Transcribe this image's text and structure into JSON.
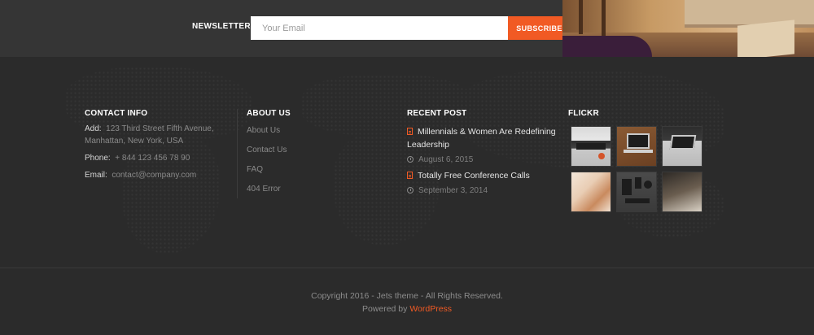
{
  "newsletter": {
    "label": "NEWSLETTER",
    "email_placeholder": "Your Email",
    "subscribe_label": "SUBSCRIBE"
  },
  "contact": {
    "title": "CONTACT INFO",
    "address_label": "Add:",
    "address_value": "123 Third Street Fifth Avenue, Manhattan, New York, USA",
    "phone_label": "Phone:",
    "phone_value": "+ 844 123 456 78 90",
    "email_label": "Email:",
    "email_value": "contact@company.com"
  },
  "about": {
    "title": "ABOUT US",
    "links": [
      "About Us",
      "Contact Us",
      "FAQ",
      "404 Error"
    ]
  },
  "recent": {
    "title": "RECENT POST",
    "posts": [
      {
        "title": "Millennials & Women Are Redefining Leadership",
        "date": "August 6, 2015"
      },
      {
        "title": "Totally Free Conference Calls",
        "date": "September 3, 2014"
      }
    ]
  },
  "flickr": {
    "title": "FLICKR",
    "thumbs": [
      "desk-keyboard-photo",
      "laptop-on-wood-photo",
      "macbook-photo",
      "colorful-desk-photo",
      "gadgets-flatlay-photo",
      "cameras-photo"
    ]
  },
  "footer": {
    "copyright": "Copyright 2016 - Jets theme - All Rights Reserved.",
    "powered_prefix": "Powered by ",
    "powered_link": "WordPress"
  },
  "colors": {
    "accent": "#f15a24",
    "background": "#2b2b2b",
    "newsletter_band": "#353535"
  }
}
